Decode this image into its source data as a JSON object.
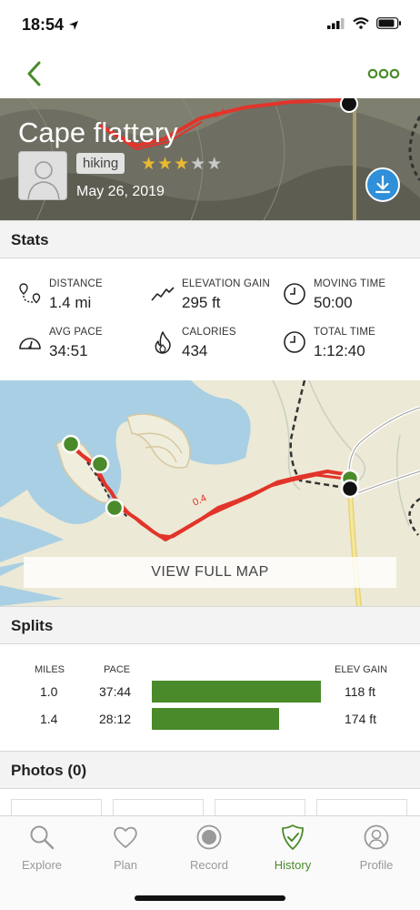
{
  "status_bar": {
    "time": "18:54"
  },
  "header": {
    "title": "Cape flattery",
    "activity_tag": "hiking",
    "date": "May 26, 2019",
    "rating": 3,
    "rating_max": 5,
    "map_trail_label": "0.4"
  },
  "sections": {
    "stats": "Stats",
    "splits": "Splits",
    "photos": "Photos (0)"
  },
  "stats": {
    "distance": {
      "label": "DISTANCE",
      "value": "1.4 mi",
      "icon": "route-pin-icon"
    },
    "elevation_gain": {
      "label": "ELEVATION GAIN",
      "value": "295 ft",
      "icon": "elevation-zigzag-icon"
    },
    "moving_time": {
      "label": "MOVING TIME",
      "value": "50:00",
      "icon": "clock-icon"
    },
    "avg_pace": {
      "label": "AVG PACE",
      "value": "34:51",
      "icon": "speedometer-icon"
    },
    "calories": {
      "label": "CALORIES",
      "value": "434",
      "icon": "flame-icon"
    },
    "total_time": {
      "label": "TOTAL TIME",
      "value": "1:12:40",
      "icon": "clock-icon"
    }
  },
  "map": {
    "trail_label": "0.4",
    "view_full_map": "VIEW FULL MAP"
  },
  "splits": {
    "headers": {
      "miles": "MILES",
      "pace": "PACE",
      "elev_gain": "ELEV GAIN"
    },
    "rows": [
      {
        "miles": "1.0",
        "pace": "37:44",
        "elev_gain": "118 ft",
        "pace_fraction": 1.0
      },
      {
        "miles": "1.4",
        "pace": "28:12",
        "elev_gain": "174 ft",
        "pace_fraction": 0.75
      }
    ]
  },
  "tabs": [
    {
      "label": "Explore",
      "icon": "search-icon",
      "active": false
    },
    {
      "label": "Plan",
      "icon": "heart-icon",
      "active": false
    },
    {
      "label": "Record",
      "icon": "record-icon",
      "active": false
    },
    {
      "label": "History",
      "icon": "shield-check-icon",
      "active": true
    },
    {
      "label": "Profile",
      "icon": "profile-icon",
      "active": false
    }
  ],
  "colors": {
    "accent_green": "#4a8a2a",
    "trail_red": "#e2342a",
    "download_blue": "#2f8fd8",
    "star_gold": "#e8b931"
  }
}
